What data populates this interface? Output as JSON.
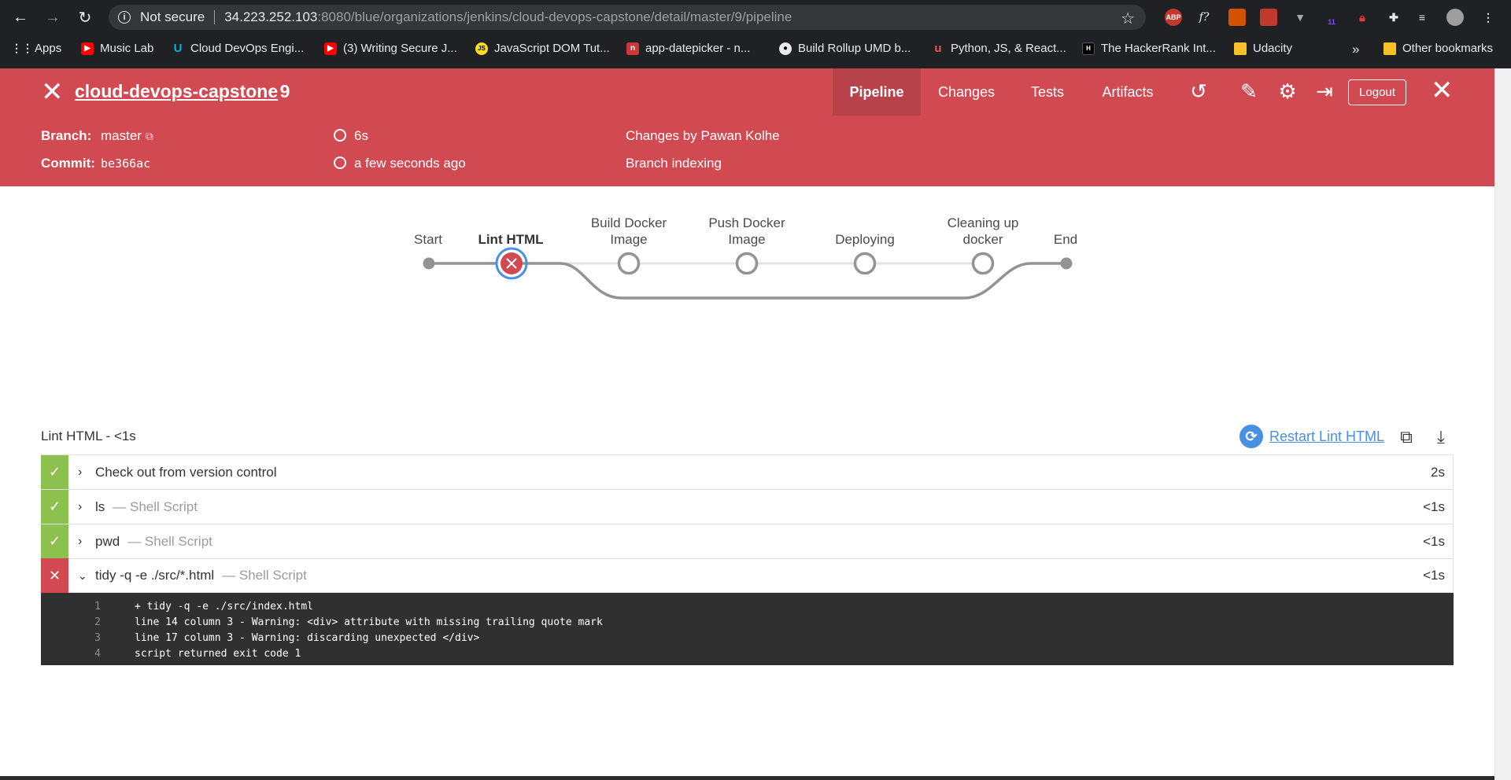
{
  "browser": {
    "address": {
      "security_label": "Not secure",
      "host": "34.223.252.103",
      "path": ":8080/blue/organizations/jenkins/cloud-devops-capstone/detail/master/9/pipeline"
    },
    "extensions": [
      "ABP",
      "f?",
      "11"
    ],
    "bookmarks": [
      {
        "label": "Apps",
        "icon": "apps-grid-icon"
      },
      {
        "label": "Music Lab",
        "icon": "youtube-icon"
      },
      {
        "label": "Cloud DevOps Engi...",
        "icon": "udacity-icon"
      },
      {
        "label": "(3) Writing Secure J...",
        "icon": "youtube-icon"
      },
      {
        "label": "JavaScript DOM Tut...",
        "icon": "js-icon"
      },
      {
        "label": "app-datepicker - n...",
        "icon": "npm-icon"
      },
      {
        "label": "Build Rollup UMD b...",
        "icon": "medium-icon"
      },
      {
        "label": "Python, JS, & React...",
        "icon": "udemy-icon"
      },
      {
        "label": "The HackerRank Int...",
        "icon": "hackerrank-icon"
      },
      {
        "label": "Udacity",
        "icon": "folder-icon"
      }
    ],
    "more_bookmarks": "»",
    "other_bookmarks": "Other bookmarks"
  },
  "run": {
    "title": "cloud-devops-capstone",
    "number_chevron": "‹",
    "number": "9",
    "tabs": [
      "Pipeline",
      "Changes",
      "Tests",
      "Artifacts"
    ],
    "logout": "Logout",
    "colors": {
      "failure": "#d24a51",
      "success": "#8cc04f",
      "link": "#4a90e2"
    }
  },
  "meta": {
    "branch_label": "Branch:",
    "branch": "master",
    "commit_label": "Commit:",
    "commit": "be366ac",
    "duration": "6s",
    "started": "a few seconds ago",
    "changes": "Changes by Pawan Kolhe",
    "cause": "Branch indexing"
  },
  "pipeline": {
    "stages": [
      {
        "label": "Start",
        "state": "start"
      },
      {
        "label": "Lint HTML",
        "state": "failed"
      },
      {
        "label": "Build Docker Image",
        "state": "not-built"
      },
      {
        "label": "Push Docker Image",
        "state": "not-built"
      },
      {
        "label": "Deploying",
        "state": "not-built"
      },
      {
        "label": "Cleaning up docker",
        "state": "not-built"
      },
      {
        "label": "End",
        "state": "end"
      }
    ]
  },
  "steps_panel": {
    "title": "Lint HTML - <1s",
    "restart_label": "Restart Lint HTML",
    "steps": [
      {
        "name": "Check out from version control",
        "type": "",
        "duration": "2s",
        "status": "ok",
        "expanded": false
      },
      {
        "name": "ls",
        "type": "— Shell Script",
        "duration": "<1s",
        "status": "ok",
        "expanded": false
      },
      {
        "name": "pwd",
        "type": "— Shell Script",
        "duration": "<1s",
        "status": "ok",
        "expanded": false
      },
      {
        "name": "tidy -q -e ./src/*.html",
        "type": "— Shell Script",
        "duration": "<1s",
        "status": "fail",
        "expanded": true
      }
    ],
    "log": [
      {
        "n": "1",
        "text": "+ tidy -q -e ./src/index.html"
      },
      {
        "n": "2",
        "text": "line 14 column 3 - Warning: <div> attribute with missing trailing quote mark"
      },
      {
        "n": "3",
        "text": "line 17 column 3 - Warning: discarding unexpected </div>"
      },
      {
        "n": "4",
        "text": "script returned exit code 1"
      }
    ]
  }
}
